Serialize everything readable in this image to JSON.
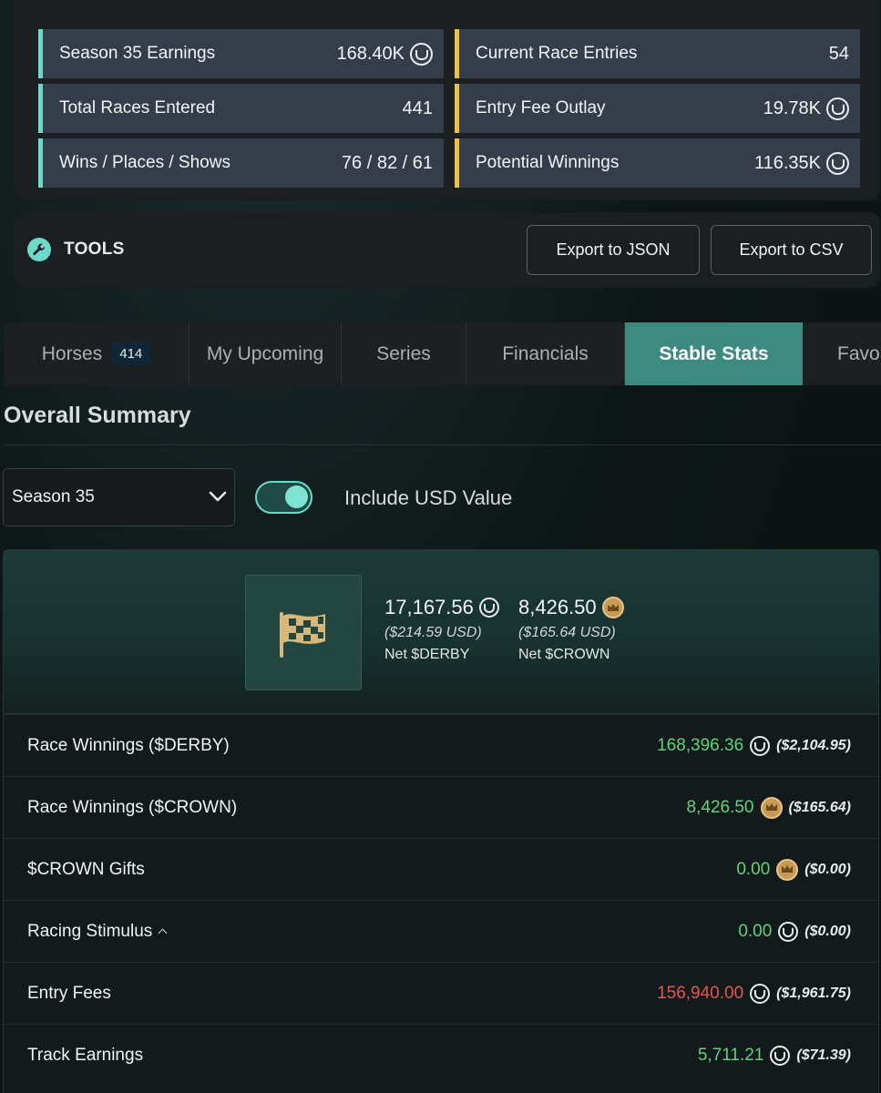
{
  "stats": {
    "left": [
      {
        "label": "Season 35 Earnings",
        "value": "168.40K",
        "icon": "derby-icon"
      },
      {
        "label": "Total Races Entered",
        "value": "441",
        "icon": ""
      },
      {
        "label": "Wins / Places / Shows",
        "value": "76 / 82 / 61",
        "icon": ""
      }
    ],
    "right": [
      {
        "label": "Current Race Entries",
        "value": "54",
        "icon": ""
      },
      {
        "label": "Entry Fee Outlay",
        "value": "19.78K",
        "icon": "derby-icon"
      },
      {
        "label": "Potential Winnings",
        "value": "116.35K",
        "icon": "derby-icon"
      }
    ]
  },
  "tools": {
    "title": "TOOLS",
    "export_json": "Export to JSON",
    "export_csv": "Export to CSV"
  },
  "tabs": [
    {
      "label": "Horses",
      "badge": "414",
      "active": false
    },
    {
      "label": "My Upcoming",
      "active": false
    },
    {
      "label": "Series",
      "active": false
    },
    {
      "label": "Financials",
      "active": false
    },
    {
      "label": "Stable Stats",
      "active": true
    },
    {
      "label": "Favor",
      "active": false
    }
  ],
  "summary": {
    "title": "Overall Summary",
    "season_selected": "Season 35",
    "toggle_label": "Include USD Value",
    "toggle_on": true
  },
  "net": {
    "derby": {
      "amount": "17,167.56",
      "usd": "($214.59 USD)",
      "label": "Net $DERBY"
    },
    "crown": {
      "amount": "8,426.50",
      "usd": "($165.64 USD)",
      "label": "Net $CROWN"
    }
  },
  "lines": [
    {
      "label": "Race Winnings ($DERBY)",
      "value": "168,396.36",
      "usd": "($2,104.95)",
      "icon": "derby-icon",
      "sign": "pos",
      "caret": false
    },
    {
      "label": "Race Winnings ($CROWN)",
      "value": "8,426.50",
      "usd": "($165.64)",
      "icon": "crown-icon",
      "sign": "pos",
      "caret": false
    },
    {
      "label": "$CROWN Gifts",
      "value": "0.00",
      "usd": "($0.00)",
      "icon": "crown-icon",
      "sign": "pos",
      "caret": false
    },
    {
      "label": "Racing Stimulus",
      "value": "0.00",
      "usd": "($0.00)",
      "icon": "derby-icon",
      "sign": "pos",
      "caret": true
    },
    {
      "label": "Entry Fees",
      "value": "156,940.00",
      "usd": "($1,961.75)",
      "icon": "derby-icon",
      "sign": "neg",
      "caret": false
    },
    {
      "label": "Track Earnings",
      "value": "5,711.21",
      "usd": "($71.39)",
      "icon": "derby-icon",
      "sign": "pos",
      "caret": false
    }
  ],
  "colors": {
    "accent_teal": "#6fd9c9",
    "accent_gold": "#e8c34c",
    "active_tab": "#3d8b80",
    "positive": "#5fd27b",
    "negative": "#e5564f"
  }
}
